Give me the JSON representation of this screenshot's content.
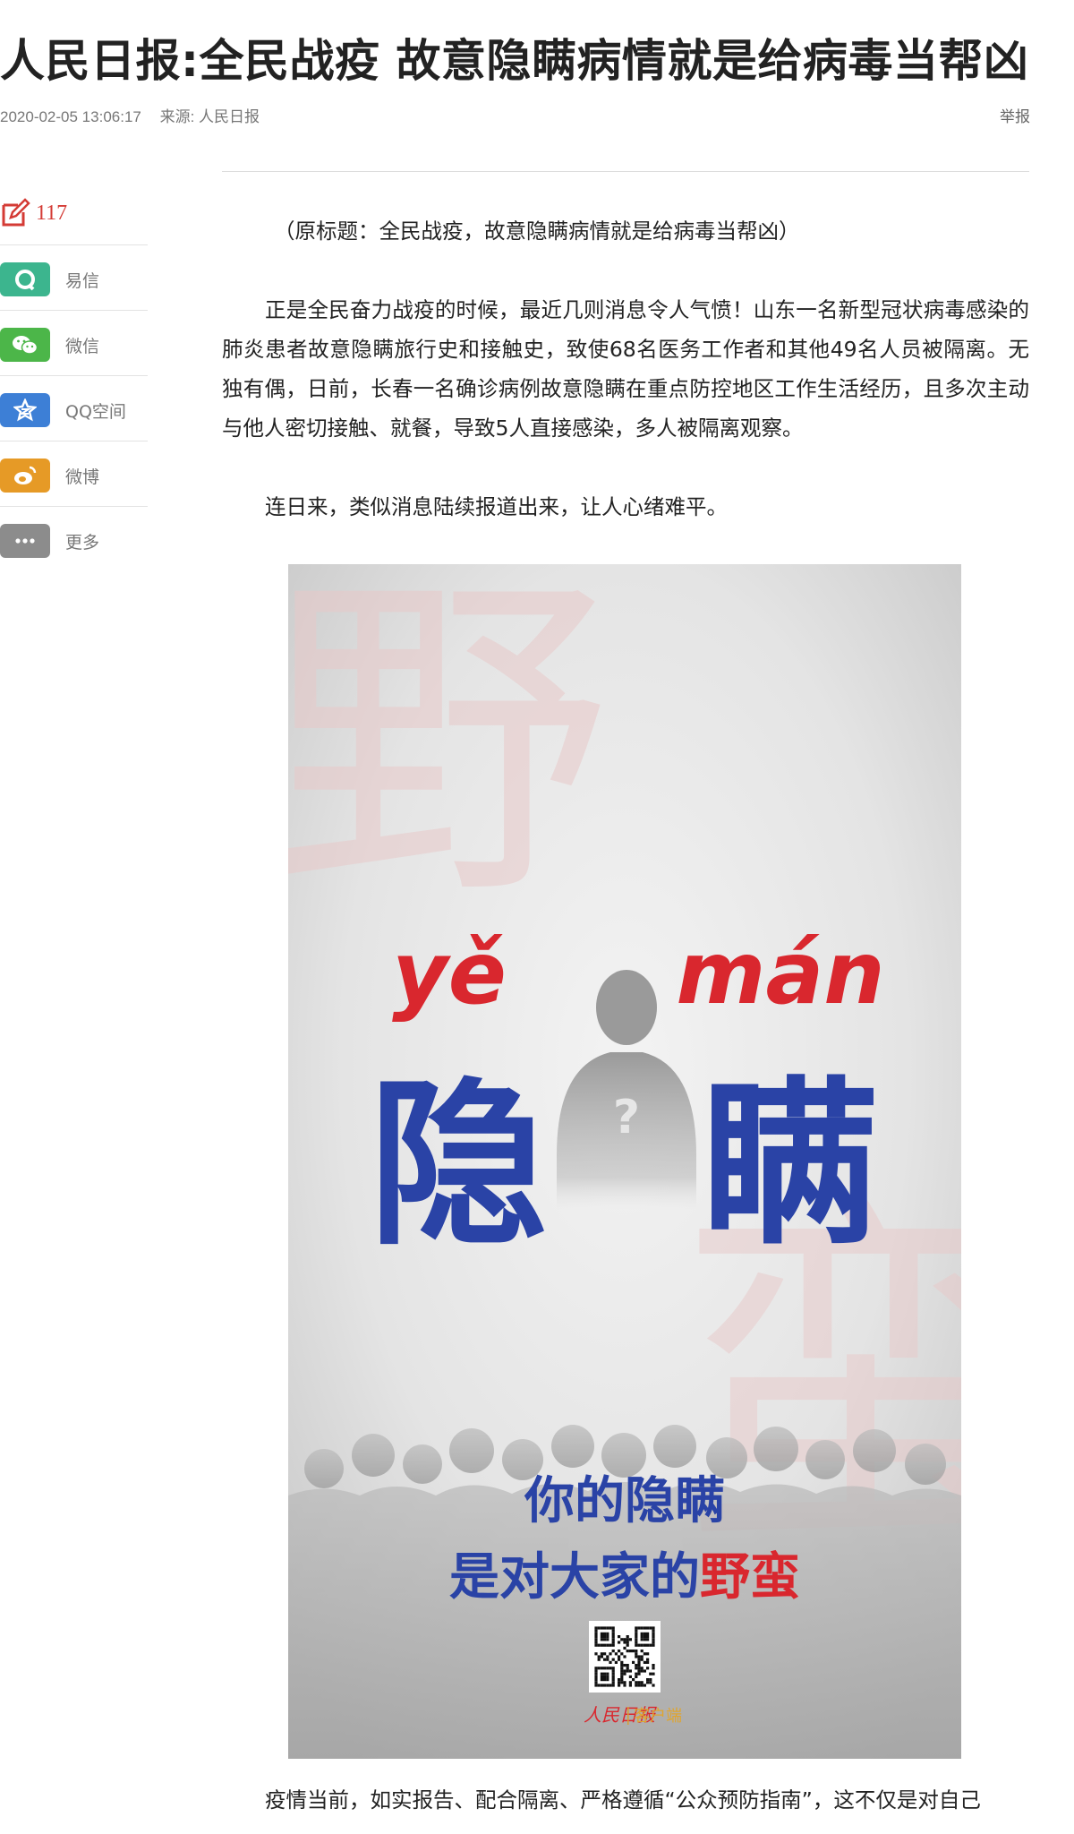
{
  "article": {
    "title": "人民日报:全民战疫 故意隐瞒病情就是给病毒当帮凶",
    "datetime": "2020-02-05 13:06:17",
    "source": "来源: 人民日报",
    "report_label": "举报",
    "paragraphs": [
      "（原标题：全民战疫，故意隐瞒病情就是给病毒当帮凶）",
      "正是全民奋力战疫的时候，最近几则消息令人气愤！山东一名新型冠状病毒感染的肺炎患者故意隐瞒旅行史和接触史，致使68名医务工作者和其他49名人员被隔离。无独有偶，日前，长春一名确诊病例故意隐瞒在重点防控地区工作生活经历，且多次主动与他人密切接触、就餐，导致5人直接感染，多人被隔离观察。",
      "连日来，类似消息陆续报道出来，让人心绪难平。",
      "疫情当前，如实报告、配合隔离、严格遵循“公众预防指南”，这不仅是对自己"
    ]
  },
  "share": {
    "comment_count": "117",
    "items": [
      {
        "label": "易信",
        "icon": "yixin-icon",
        "color": "#3cb58e"
      },
      {
        "label": "微信",
        "icon": "wechat-icon",
        "color": "#4cb649"
      },
      {
        "label": "QQ空间",
        "icon": "qzone-icon",
        "color": "#3d7fd6"
      },
      {
        "label": "微博",
        "icon": "weibo-icon",
        "color": "#e69a26"
      },
      {
        "label": "更多",
        "icon": "more-icon",
        "color": "#8c8c8c"
      }
    ]
  },
  "poster": {
    "pinyin_left": "yě",
    "pinyin_right": "mán",
    "big_left": "隐",
    "big_right": "瞒",
    "slogan_line1": "你的隐瞒",
    "slogan_line2_prefix": "是对大家的",
    "slogan_line2_red": "野蛮",
    "brand_logo_text": "人民日报",
    "brand_client": "客户端",
    "watermark_top": "野",
    "watermark_right": "蛮",
    "colors": {
      "blue": "#2a43a6",
      "red": "#d9272e"
    }
  }
}
